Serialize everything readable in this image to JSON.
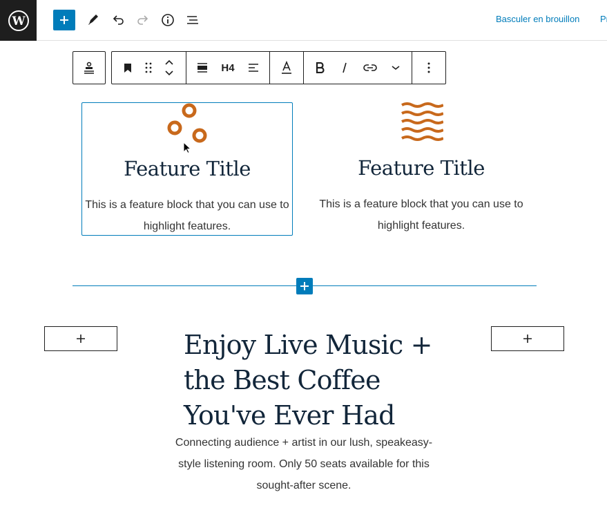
{
  "topbar": {
    "logo_icon": "wordpress-logo",
    "add_icon": "plus-icon",
    "tools_icon": "pencil-icon",
    "undo_icon": "undo-icon",
    "redo_icon": "redo-icon",
    "details_icon": "info-icon",
    "outline_icon": "list-view-icon",
    "switch_to_draft": "Basculer en brouillon",
    "preview_partial": "Pr"
  },
  "block_toolbar": {
    "parent_icon": "align-center-icon",
    "block_type_icon": "bookmark-icon",
    "drag_icon": "drag-handle-icon",
    "move_icon": "move-up-down-icon",
    "align_icon": "align-wide-icon",
    "heading_level": "H4",
    "text_align_icon": "align-left-icon",
    "text_color_icon": "text-color-icon",
    "bold_icon": "bold-icon",
    "italic_icon": "italic-icon",
    "link_icon": "link-icon",
    "more_formats_icon": "chevron-down-icon",
    "options_icon": "more-vertical-icon"
  },
  "features": [
    {
      "icon": "circles-icon",
      "title": "Feature Title",
      "text": "This is a feature block that you can use to highlight features."
    },
    {
      "icon": "waves-icon",
      "title": "Feature Title",
      "text": "This is a feature block that you can use to highlight features."
    }
  ],
  "inserter": {
    "icon": "plus-icon"
  },
  "appenders": {
    "left_icon": "plus-icon",
    "right_icon": "plus-icon"
  },
  "hero": {
    "heading": "Enjoy Live Music + the Best Coffee You've Ever Had",
    "text": "Connecting audience + artist in our lush, speakeasy-style listening room. Only 50 seats available for this sought-after scene."
  },
  "colors": {
    "accent": "#007cba",
    "icon_orange": "#c8691c",
    "heading": "#12263a",
    "topbar_dark": "#1e1e1e"
  }
}
